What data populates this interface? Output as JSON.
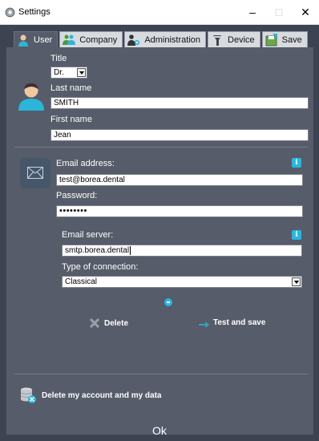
{
  "window": {
    "title": "Settings",
    "minimize": "–",
    "maximize": "□",
    "close": "✕"
  },
  "tabs": [
    {
      "label": "User",
      "icon": "user-icon",
      "active": true
    },
    {
      "label": "Company",
      "icon": "company-icon",
      "active": false
    },
    {
      "label": "Administration",
      "icon": "administration-icon",
      "active": false
    },
    {
      "label": "Device",
      "icon": "device-icon",
      "active": false
    },
    {
      "label": "Save",
      "icon": "save-icon",
      "active": false
    }
  ],
  "user": {
    "title_label": "Title",
    "title_value": "Dr.",
    "last_name_label": "Last name",
    "last_name_value": "SMITH",
    "first_name_label": "First name",
    "first_name_value": "Jean"
  },
  "email": {
    "address_label": "Email address:",
    "address_value": "test@borea.dental",
    "password_label": "Password:",
    "password_value": "••••••••",
    "server_label": "Email server:",
    "server_value": "smtp.borea.dental",
    "connection_label": "Type of connection:",
    "connection_value": "Classical",
    "info_glyph": "i"
  },
  "actions": {
    "delete_label": "Delete",
    "test_save_label": "Test and save",
    "delete_account_label": "Delete my account and my data"
  },
  "footer": {
    "ok_label": "Ok"
  },
  "colors": {
    "frame": "#3d4350",
    "panel": "#565c69",
    "accent": "#29b6e4",
    "avatar": "#2bb5d8"
  }
}
